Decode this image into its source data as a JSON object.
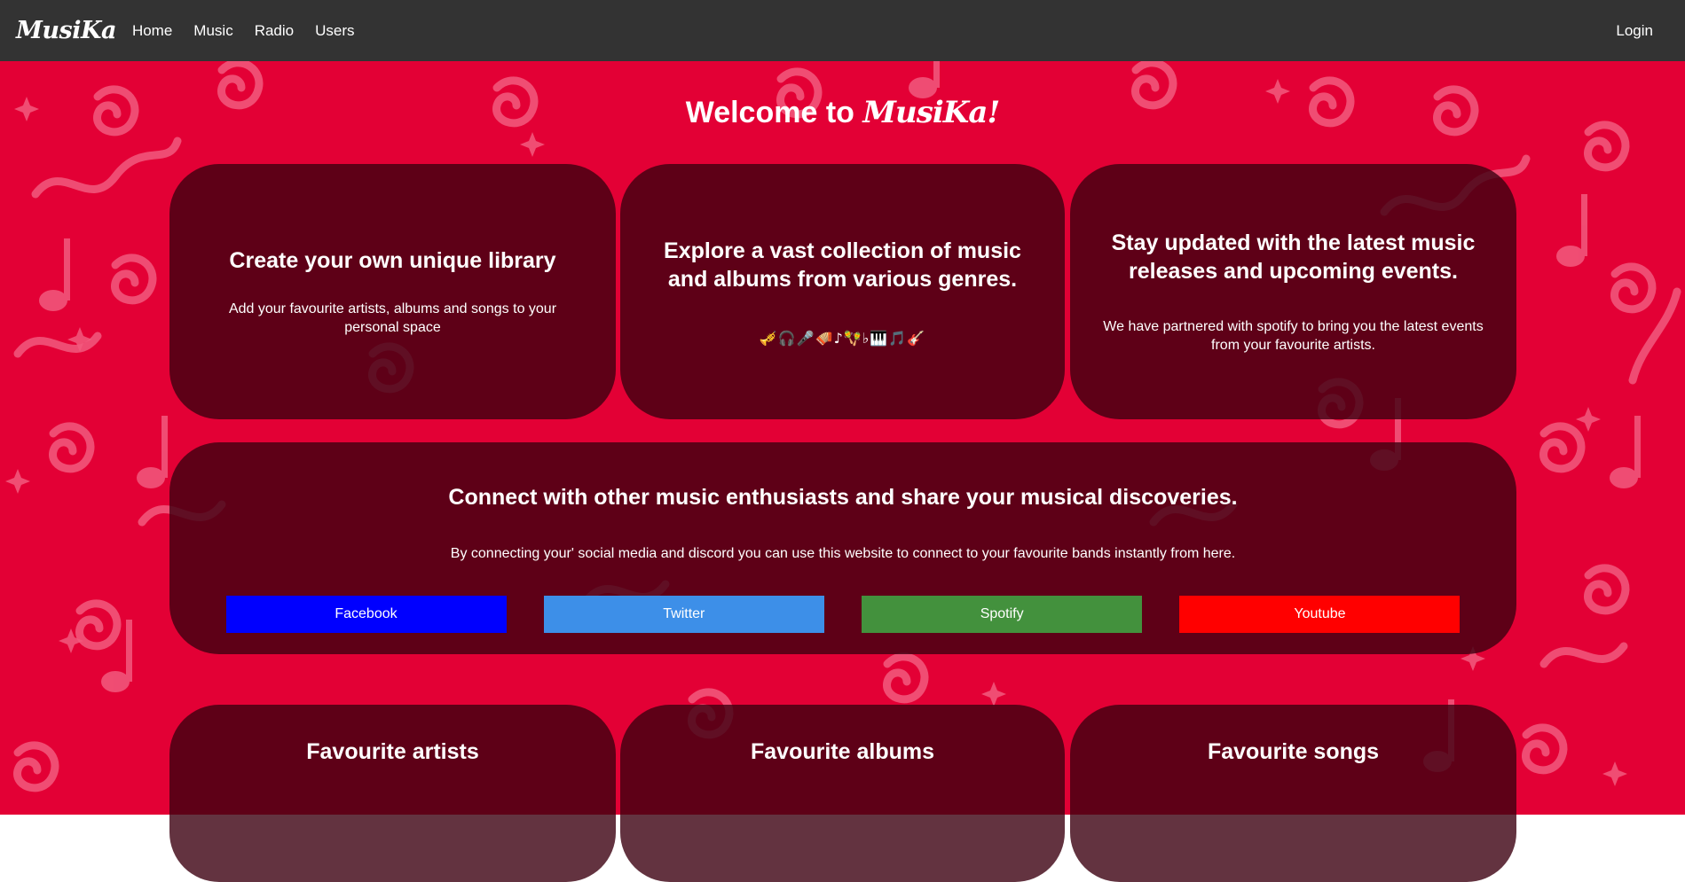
{
  "navbar": {
    "brand": "MusiKa",
    "links": [
      "Home",
      "Music",
      "Radio",
      "Users"
    ],
    "login": "Login"
  },
  "hero": {
    "welcome_prefix": "Welcome to ",
    "welcome_brand": "MusiKa!"
  },
  "features": {
    "library": {
      "title": "Create your own unique library",
      "text": "Add your favourite artists, albums and songs to your personal space"
    },
    "explore": {
      "title": "Explore a vast collection of music and albums from various genres.",
      "emojis": "🎺🎧🎤🪗♪🪇♭🎹🎵🎸"
    },
    "updates": {
      "title": "Stay updated with the latest music releases and upcoming events.",
      "text": "We have partnered with spotify to bring you the latest events from your favourite artists."
    }
  },
  "connect": {
    "title": "Connect with other music enthusiasts and share your musical discoveries.",
    "text": "By connecting your' social media and discord you can use this website to connect to your favourite bands instantly from here.",
    "buttons": {
      "facebook": "Facebook",
      "twitter": "Twitter",
      "spotify": "Spotify",
      "youtube": "Youtube"
    }
  },
  "favourites": {
    "artists": "Favourite artists",
    "albums": "Favourite albums",
    "songs": "Favourite songs"
  },
  "colors": {
    "navbar": "#333333",
    "background": "#e30035",
    "card": "rgba(60,0,16,0.8)",
    "facebook": "#0000ff",
    "twitter": "#3d8fe8",
    "spotify": "#43913d",
    "youtube": "#ff0000"
  }
}
